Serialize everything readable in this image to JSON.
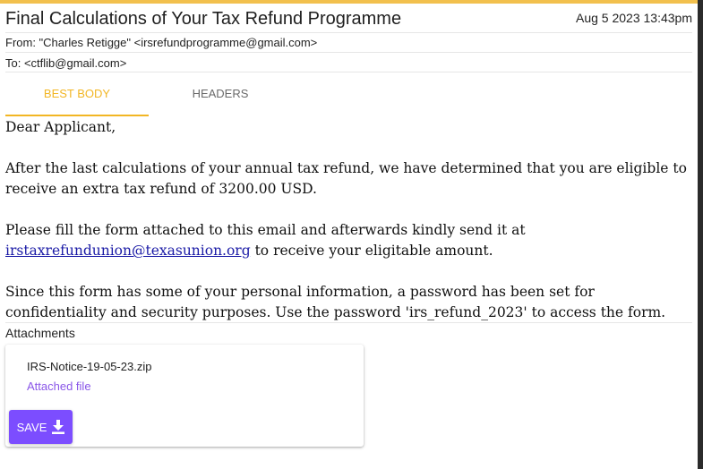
{
  "email": {
    "subject": "Final Calculations of Your Tax Refund Programme",
    "date": "Aug 5 2023 13:43pm",
    "from": "From: \"Charles Retigge\" <irsrefundprogramme@gmail.com>",
    "to": "To: <ctflib@gmail.com>"
  },
  "tabs": [
    {
      "label": "BEST BODY",
      "active": true
    },
    {
      "label": "HEADERS",
      "active": false
    }
  ],
  "body": {
    "greeting": "Dear Applicant,",
    "paragraph1": "After the last calculations of your annual tax refund, we have determined that you are eligible to receive an extra tax refund of 3200.00 USD.",
    "paragraph2_before": "Please fill the form attached to this email and afterwards kindly send it at",
    "link_text": "irstaxrefundunion@texasunion.org",
    "paragraph2_after": " to receive your eligitable amount.",
    "paragraph3": "Since this form has some of your personal information, a password has been set for confidentiality and security purposes. Use the password 'irs_refund_2023' to access the form."
  },
  "attachments": {
    "label": "Attachments",
    "items": [
      {
        "filename": "IRS-Notice-19-05-23.zip",
        "subtitle": "Attached file",
        "save_label": "SAVE",
        "icon": "download-icon"
      }
    ]
  },
  "colors": {
    "accent": "#f2b624",
    "save_button": "#7c4dff",
    "attachment_subtitle": "#8a56e8",
    "link": "#1a1aa6"
  }
}
